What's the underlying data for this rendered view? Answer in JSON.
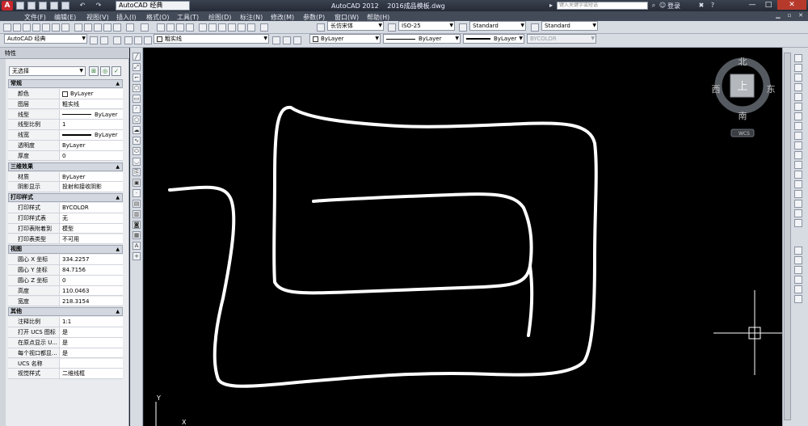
{
  "titlebar": {
    "logo": "A",
    "workspace": "AutoCAD 经典",
    "app_title": "AutoCAD 2012　 2016成品模板.dwg",
    "search_placeholder": "键入关键字或短语",
    "login": "登录",
    "minimize": "—",
    "maximize": "□",
    "close": "✕"
  },
  "menu": {
    "items": [
      "文件(F)",
      "编辑(E)",
      "视图(V)",
      "插入(I)",
      "格式(O)",
      "工具(T)",
      "绘图(D)",
      "标注(N)",
      "修改(M)",
      "参数(P)",
      "窗口(W)",
      "帮助(H)"
    ]
  },
  "toolbar1": {
    "text_style": "长仿宋体",
    "dim_style": "ISO-25",
    "table_style": "Standard",
    "multileader_style": "Standard"
  },
  "toolbar2": {
    "workspace": "AutoCAD 经典",
    "layer": "粗实线",
    "color": "ByLayer",
    "linetype": "ByLayer",
    "lineweight": "ByLayer",
    "plotstyle": "BYCOLOR"
  },
  "properties": {
    "header": "特性",
    "selection": "无选择",
    "sections": [
      {
        "title": "常规",
        "rows": [
          {
            "key": "颜色",
            "value": "ByLayer",
            "swatch": true
          },
          {
            "key": "图层",
            "value": "粗实线"
          },
          {
            "key": "线型",
            "value": "ByLayer",
            "line": "thin"
          },
          {
            "key": "线型比例",
            "value": "1"
          },
          {
            "key": "线宽",
            "value": "ByLayer",
            "line": "thick"
          },
          {
            "key": "透明度",
            "value": "ByLayer"
          },
          {
            "key": "厚度",
            "value": "0"
          }
        ]
      },
      {
        "title": "三维效果",
        "rows": [
          {
            "key": "材质",
            "value": "ByLayer"
          },
          {
            "key": "阴影显示",
            "value": "投射和接收阴影"
          }
        ]
      },
      {
        "title": "打印样式",
        "rows": [
          {
            "key": "打印样式",
            "value": "BYCOLOR"
          },
          {
            "key": "打印样式表",
            "value": "无"
          },
          {
            "key": "打印表附着到",
            "value": "模型"
          },
          {
            "key": "打印表类型",
            "value": "不可用"
          }
        ]
      },
      {
        "title": "视图",
        "rows": [
          {
            "key": "圆心 X 坐标",
            "value": "334.2257"
          },
          {
            "key": "圆心 Y 坐标",
            "value": "84.7156"
          },
          {
            "key": "圆心 Z 坐标",
            "value": "0"
          },
          {
            "key": "高度",
            "value": "110.0463"
          },
          {
            "key": "宽度",
            "value": "218.3154"
          }
        ]
      },
      {
        "title": "其他",
        "rows": [
          {
            "key": "注释比例",
            "value": "1:1"
          },
          {
            "key": "打开 UCS 图标",
            "value": "是"
          },
          {
            "key": "在原点显示 U...",
            "value": "是"
          },
          {
            "key": "每个视口都显...",
            "value": "是"
          },
          {
            "key": "UCS 名称",
            "value": ""
          },
          {
            "key": "视觉样式",
            "value": "二维线框"
          }
        ]
      }
    ]
  },
  "viewcube": {
    "north": "北",
    "south": "南",
    "east": "东",
    "west": "西",
    "face": "上",
    "ucs": "WCS"
  },
  "ucs_icon": {
    "x": "X",
    "y": "Y"
  }
}
